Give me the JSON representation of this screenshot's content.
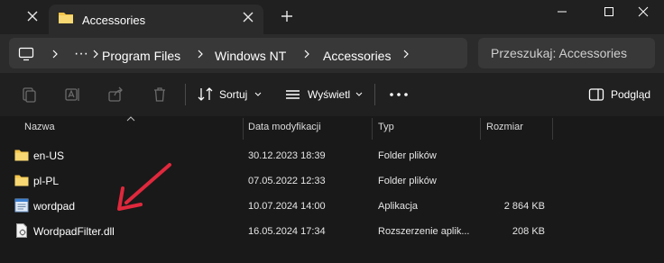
{
  "window": {
    "tab_title": "Accessories"
  },
  "breadcrumb": {
    "items": [
      "Program Files",
      "Windows NT",
      "Accessories"
    ]
  },
  "search": {
    "placeholder": "Przeszukaj: Accessories"
  },
  "toolbar": {
    "sort_label": "Sortuj",
    "view_label": "Wyświetl",
    "preview_label": "Podgląd"
  },
  "columns": {
    "name": "Nazwa",
    "modified": "Data modyfikacji",
    "type": "Typ",
    "size": "Rozmiar"
  },
  "files": [
    {
      "name": "en-US",
      "modified": "30.12.2023 18:39",
      "type": "Folder plików",
      "size": "",
      "icon": "folder-icon"
    },
    {
      "name": "pl-PL",
      "modified": "07.05.2022 12:33",
      "type": "Folder plików",
      "size": "",
      "icon": "folder-icon"
    },
    {
      "name": "wordpad",
      "modified": "10.07.2024 14:00",
      "type": "Aplikacja",
      "size": "2 864 KB",
      "icon": "app-icon"
    },
    {
      "name": "WordpadFilter.dll",
      "modified": "16.05.2024 17:34",
      "type": "Rozszerzenie aplik...",
      "size": "208 KB",
      "icon": "dll-icon"
    }
  ],
  "colors": {
    "folder": "#f3c54a",
    "annotation_arrow": "#e0283c"
  }
}
